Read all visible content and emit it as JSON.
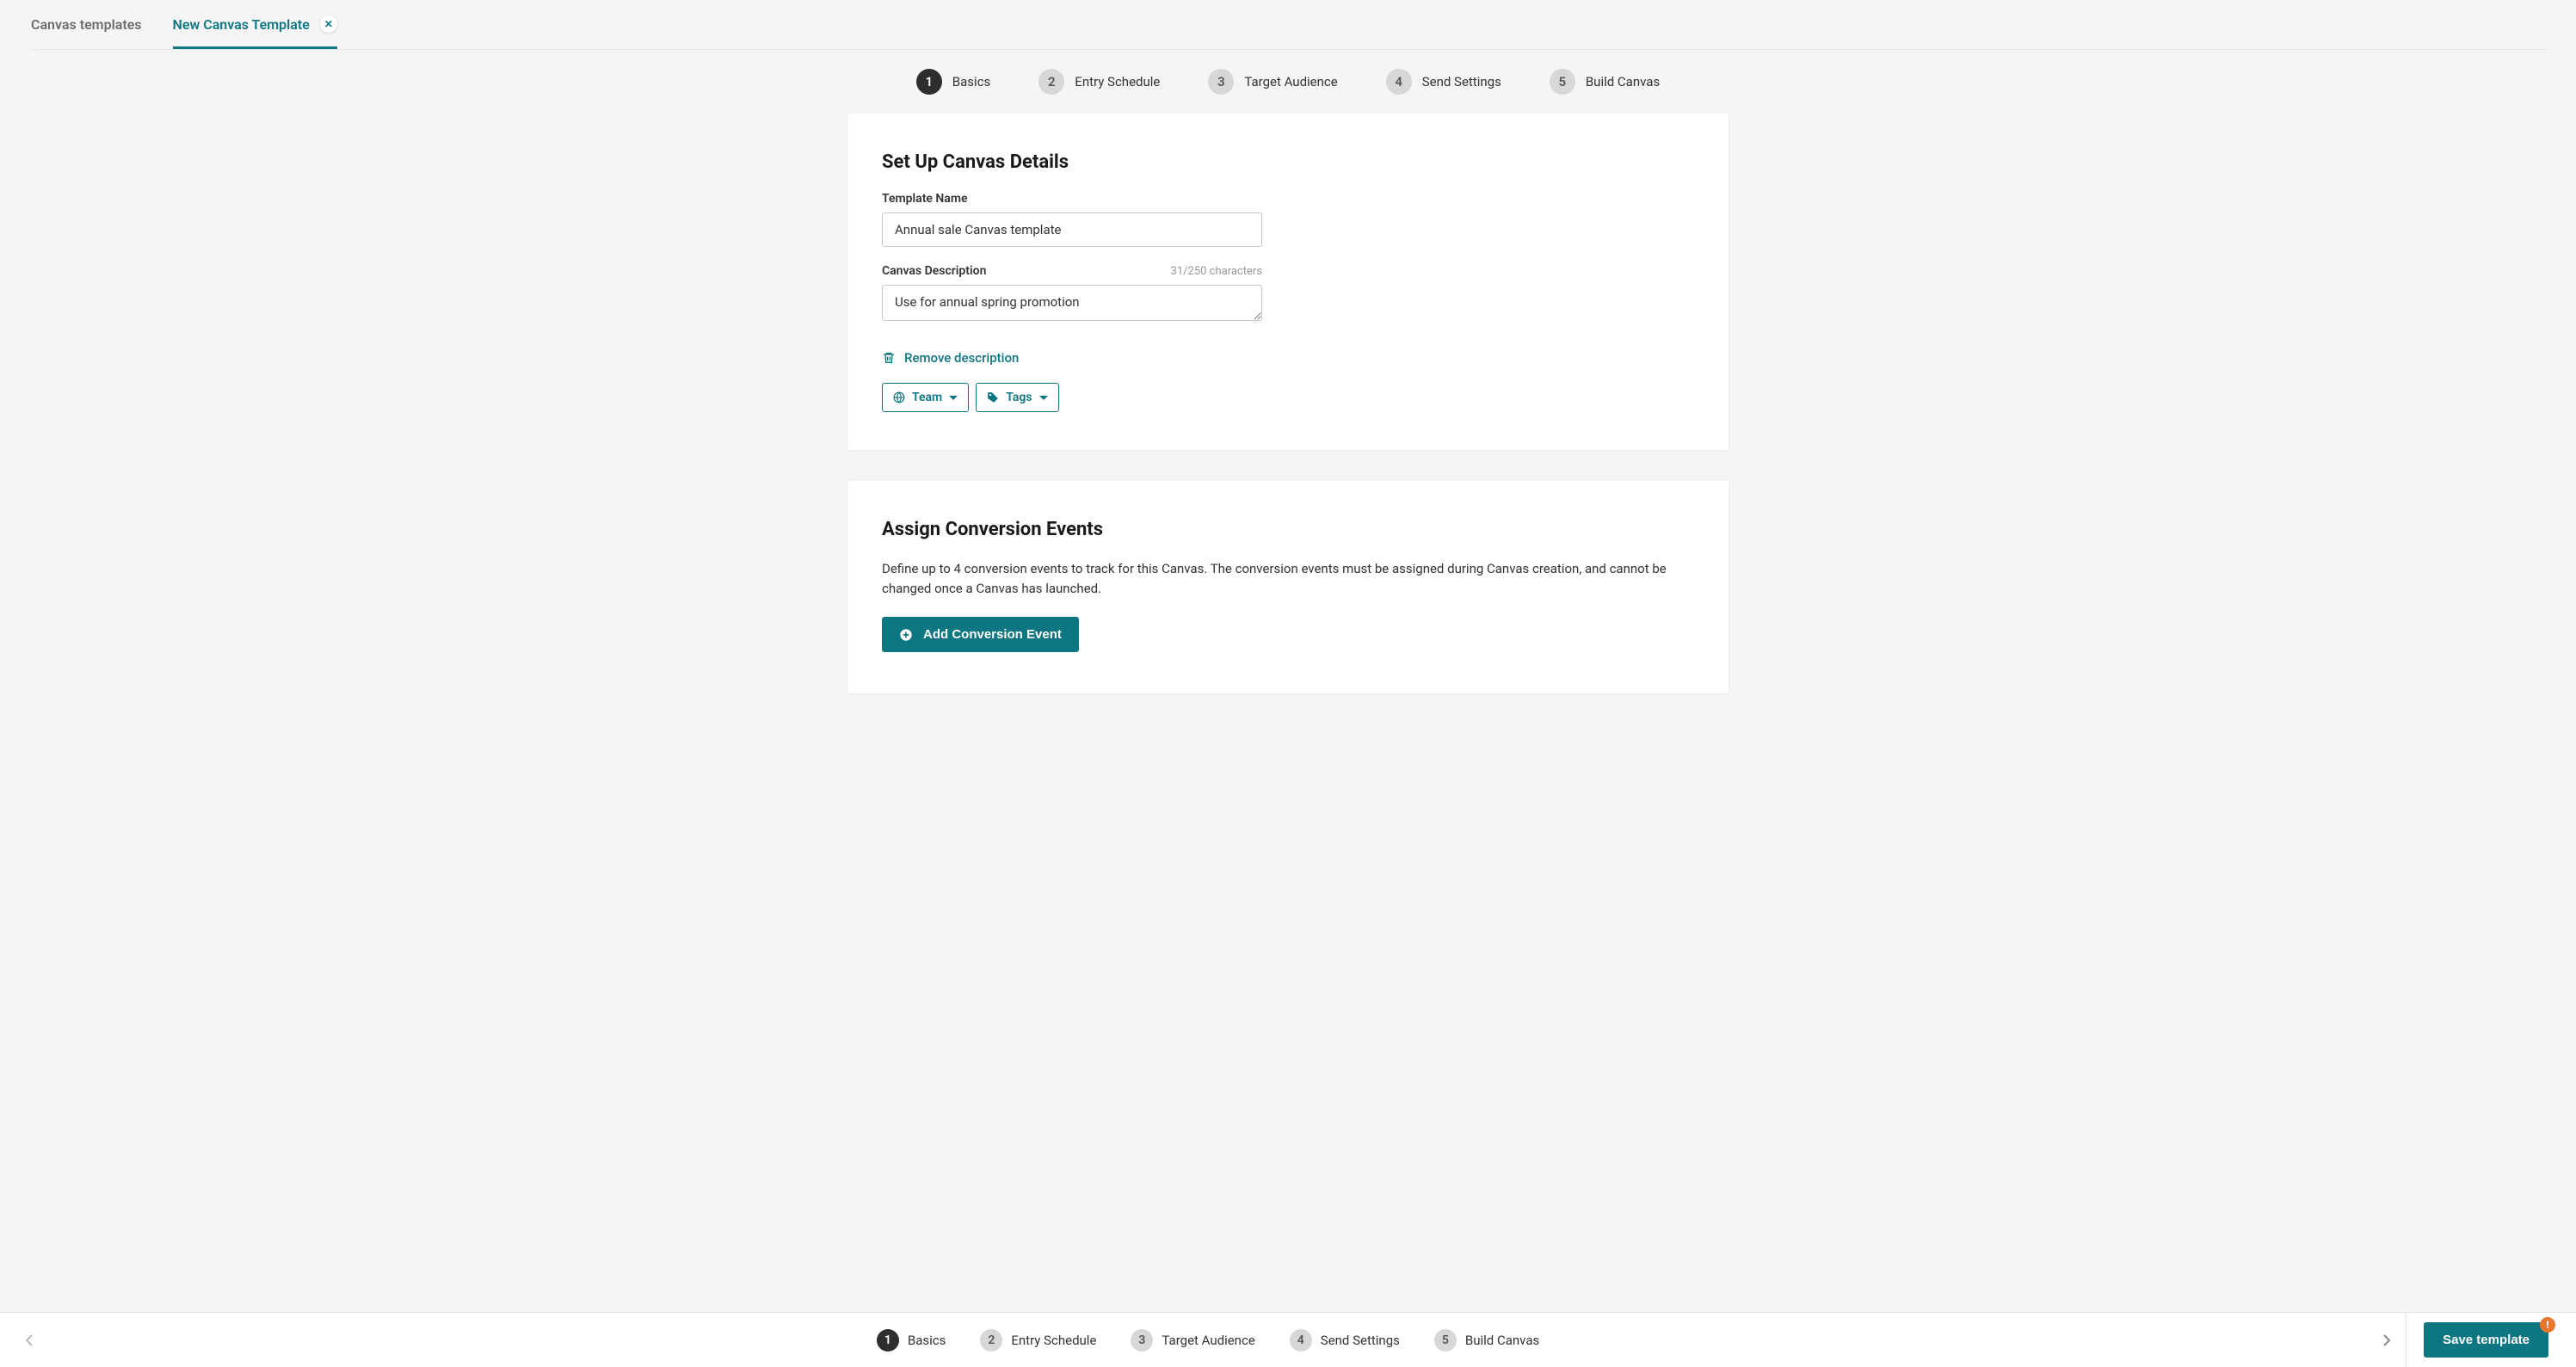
{
  "tabs": [
    {
      "label": "Canvas templates",
      "active": false,
      "closable": false
    },
    {
      "label": "New Canvas Template",
      "active": true,
      "closable": true
    }
  ],
  "steps": [
    {
      "num": "1",
      "label": "Basics",
      "active": true
    },
    {
      "num": "2",
      "label": "Entry Schedule",
      "active": false
    },
    {
      "num": "3",
      "label": "Target Audience",
      "active": false
    },
    {
      "num": "4",
      "label": "Send Settings",
      "active": false
    },
    {
      "num": "5",
      "label": "Build Canvas",
      "active": false
    }
  ],
  "details_card": {
    "heading": "Set Up Canvas Details",
    "name_label": "Template Name",
    "name_value": "Annual sale Canvas template",
    "desc_label": "Canvas Description",
    "desc_value": "Use for annual spring promotion",
    "char_count": "31/250 characters",
    "remove_desc": "Remove description",
    "team_label": "Team",
    "tags_label": "Tags"
  },
  "conversion_card": {
    "heading": "Assign Conversion Events",
    "body": "Define up to 4 conversion events to track for this Canvas. The conversion events must be assigned during Canvas creation, and cannot be changed once a Canvas has launched.",
    "add_button": "Add Conversion Event"
  },
  "footer": {
    "save_label": "Save template",
    "warn_symbol": "!"
  }
}
